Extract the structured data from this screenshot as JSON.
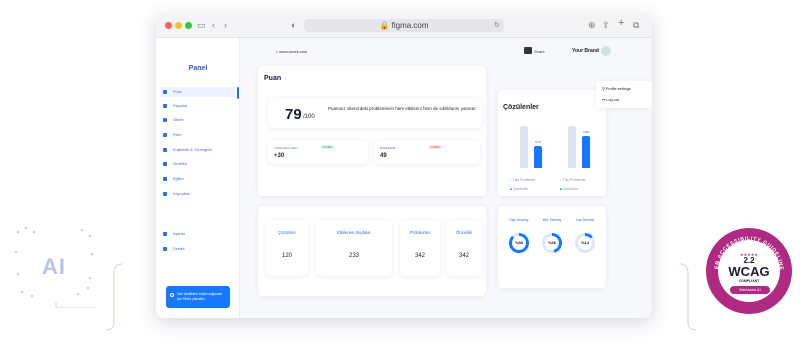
{
  "ai_badge": {
    "text": "AI"
  },
  "browser": {
    "url": "figma.com"
  },
  "sidebar": {
    "title": "Panel",
    "items": [
      {
        "label": "Puan"
      },
      {
        "label": "Raporlar"
      },
      {
        "label": "Siteler"
      },
      {
        "label": "Filtre"
      },
      {
        "label": "Erişilebilir & Yönergeler"
      },
      {
        "label": "Sertifika"
      },
      {
        "label": "Eğitim"
      },
      {
        "label": "Kaynaklar"
      },
      {
        "label": "Ayarlar"
      },
      {
        "label": "Destek"
      }
    ],
    "notice": "Tam özelliklere erişim sağlamak için Pilot'u yükseltin"
  },
  "topbar": {
    "site_link": "www.ornek.com",
    "share_label": "Share",
    "user_name": "Your Brand"
  },
  "user_menu": {
    "items": [
      {
        "label": "Profile settings"
      },
      {
        "label": "Log out"
      }
    ]
  },
  "score": {
    "title": "Puan",
    "value": "79",
    "denominator": "/100",
    "description": "Puanınız sitenizdeki problemlerin hem etkilerini hem de sıklıklarını yansıtır.",
    "progress_fraction": 0.79
  },
  "stats": [
    {
      "label": "Yönlendirme Skor",
      "badge": "+5.48%",
      "value": "+30",
      "badge_color": "#23a559"
    },
    {
      "label": "Erişilebilirlik",
      "badge": "-4.58%",
      "value": "49",
      "badge_color": "#e04848"
    }
  ],
  "metrics": [
    {
      "label": "Çözümler",
      "value": "120"
    },
    {
      "label": "Etkilenen Sayfalar",
      "value": "233"
    },
    {
      "label": "Problemler",
      "value": "342"
    },
    {
      "label": "Öncelikli",
      "value": "342"
    }
  ],
  "solutions": {
    "title": "Çözülenler",
    "legend": [
      {
        "label": "Tüm Problemler",
        "color": "#d8deef"
      },
      {
        "label": "Çözülenler",
        "color": "#1677ff"
      }
    ],
    "legend_secondary": [
      {
        "label": "Tüm Problemler"
      },
      {
        "label": "Çözülenler"
      }
    ]
  },
  "severity": [
    {
      "label": "High Severity",
      "value": "%88",
      "fraction": 0.88
    },
    {
      "label": "Mid. Severity",
      "value": "%46",
      "fraction": 0.46
    },
    {
      "label": "Low Severity",
      "value": "%14",
      "fraction": 0.14
    }
  ],
  "chart_data": {
    "type": "bar",
    "categories": [
      "1",
      "2"
    ],
    "series": [
      {
        "name": "Tüm Problemler",
        "values": [
          342,
          342
        ]
      },
      {
        "name": "Çözülenler",
        "values": [
          120,
          233
        ]
      }
    ],
    "data_labels": [
      "%75",
      "%65"
    ],
    "title": "Çözülenler"
  },
  "wcag_badge": {
    "arc_text": "WEB ACCESSIBILITY GUIDELINES",
    "version": "2.2",
    "name": "WCAG",
    "status": "COMPLIANT",
    "brand": "WeAssist.AI",
    "color": "#b02a83"
  }
}
